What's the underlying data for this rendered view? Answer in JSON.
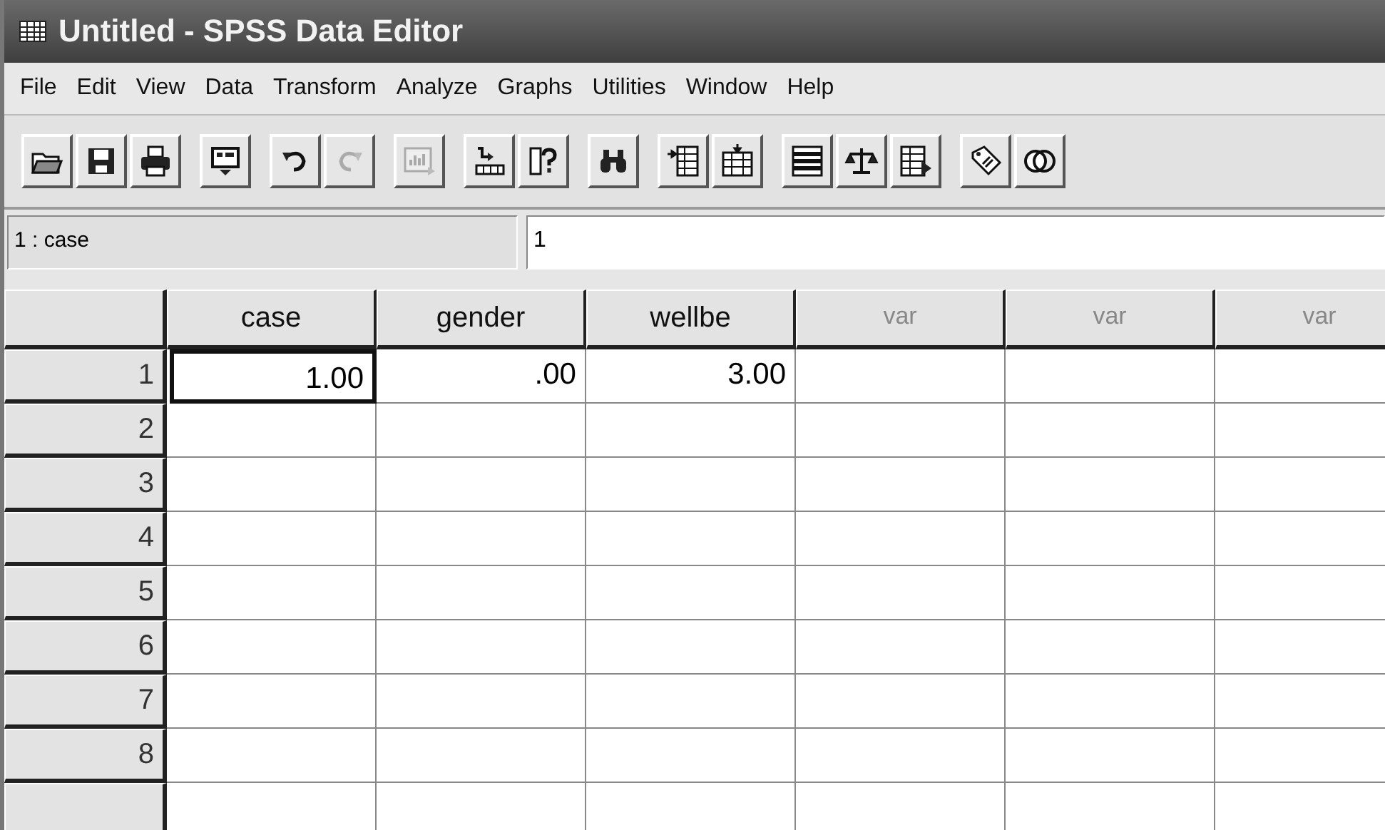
{
  "window": {
    "title": "Untitled - SPSS Data Editor"
  },
  "menu": [
    "File",
    "Edit",
    "View",
    "Data",
    "Transform",
    "Analyze",
    "Graphs",
    "Utilities",
    "Window",
    "Help"
  ],
  "toolbar": [
    [
      {
        "kind": "open",
        "disabled": false
      },
      {
        "kind": "save",
        "disabled": false
      },
      {
        "kind": "print",
        "disabled": false
      }
    ],
    [
      {
        "kind": "dialog",
        "disabled": false
      }
    ],
    [
      {
        "kind": "undo",
        "disabled": false
      },
      {
        "kind": "redo",
        "disabled": true
      }
    ],
    [
      {
        "kind": "chart",
        "disabled": true
      }
    ],
    [
      {
        "kind": "goto",
        "disabled": false
      },
      {
        "kind": "variables",
        "disabled": false
      }
    ],
    [
      {
        "kind": "find",
        "disabled": false
      }
    ],
    [
      {
        "kind": "insert-case",
        "disabled": false
      },
      {
        "kind": "insert-variable",
        "disabled": false
      }
    ],
    [
      {
        "kind": "split",
        "disabled": false
      },
      {
        "kind": "weight",
        "disabled": false
      },
      {
        "kind": "select",
        "disabled": false
      }
    ],
    [
      {
        "kind": "labels",
        "disabled": false
      },
      {
        "kind": "sets",
        "disabled": false
      }
    ]
  ],
  "cell_editor": {
    "reference": "1 : case",
    "value": "1"
  },
  "table": {
    "columns": [
      {
        "label": "case",
        "defined": true
      },
      {
        "label": "gender",
        "defined": true
      },
      {
        "label": "wellbe",
        "defined": true
      },
      {
        "label": "var",
        "defined": false
      },
      {
        "label": "var",
        "defined": false
      },
      {
        "label": "var",
        "defined": false
      }
    ],
    "rows": [
      {
        "number": "1",
        "cells": [
          {
            "value": "1.00",
            "selected": true
          },
          {
            "value": ".00",
            "selected": false
          },
          {
            "value": "3.00",
            "selected": false
          },
          {
            "selected": false
          },
          {
            "selected": false
          },
          {
            "selected": false
          }
        ]
      },
      {
        "number": "2",
        "cells": [
          {
            "selected": false
          },
          {
            "selected": false
          },
          {
            "selected": false
          },
          {
            "selected": false
          },
          {
            "selected": false
          },
          {
            "selected": false
          }
        ]
      },
      {
        "number": "3",
        "cells": [
          {
            "selected": false
          },
          {
            "selected": false
          },
          {
            "selected": false
          },
          {
            "selected": false
          },
          {
            "selected": false
          },
          {
            "selected": false
          }
        ]
      },
      {
        "number": "4",
        "cells": [
          {
            "selected": false
          },
          {
            "selected": false
          },
          {
            "selected": false
          },
          {
            "selected": false
          },
          {
            "selected": false
          },
          {
            "selected": false
          }
        ]
      },
      {
        "number": "5",
        "cells": [
          {
            "selected": false
          },
          {
            "selected": false
          },
          {
            "selected": false
          },
          {
            "selected": false
          },
          {
            "selected": false
          },
          {
            "selected": false
          }
        ]
      },
      {
        "number": "6",
        "cells": [
          {
            "selected": false
          },
          {
            "selected": false
          },
          {
            "selected": false
          },
          {
            "selected": false
          },
          {
            "selected": false
          },
          {
            "selected": false
          }
        ]
      },
      {
        "number": "7",
        "cells": [
          {
            "selected": false
          },
          {
            "selected": false
          },
          {
            "selected": false
          },
          {
            "selected": false
          },
          {
            "selected": false
          },
          {
            "selected": false
          }
        ]
      },
      {
        "number": "8",
        "cells": [
          {
            "selected": false
          },
          {
            "selected": false
          },
          {
            "selected": false
          },
          {
            "selected": false
          },
          {
            "selected": false
          },
          {
            "selected": false
          }
        ]
      }
    ]
  }
}
